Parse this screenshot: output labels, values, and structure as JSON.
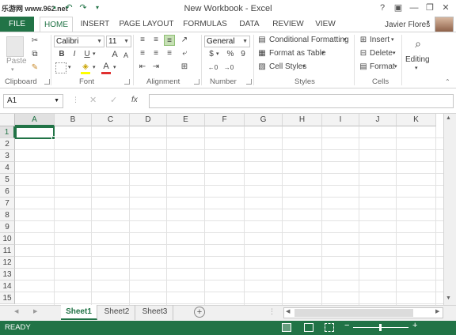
{
  "window": {
    "watermark": "乐游网 www.962.net",
    "title": "New Workbook - Excel",
    "controls": [
      "?",
      "▣",
      "—",
      "❐",
      "✕"
    ]
  },
  "qat": [
    "save-icon",
    "undo-icon",
    "redo-icon"
  ],
  "ribbon": {
    "file_tab": "FILE",
    "tabs": [
      "HOME",
      "INSERT",
      "PAGE LAYOUT",
      "FORMULAS",
      "DATA",
      "REVIEW",
      "VIEW"
    ],
    "active_tab": "HOME",
    "user": "Javier Flores",
    "groups": {
      "clipboard": {
        "label": "Clipboard",
        "paste": "Paste"
      },
      "font": {
        "label": "Font",
        "font_name": "Calibri",
        "font_size": "11",
        "bold": "B",
        "italic": "I",
        "underline": "U"
      },
      "alignment": {
        "label": "Alignment"
      },
      "number": {
        "label": "Number",
        "format": "General",
        "currency": "$",
        "percent": "%",
        "comma": "9"
      },
      "styles": {
        "label": "Styles",
        "conditional": "Conditional Formatting",
        "format_table": "Format as Table",
        "cell_styles": "Cell Styles"
      },
      "cells": {
        "label": "Cells",
        "insert": "Insert",
        "delete": "Delete",
        "format": "Format"
      },
      "editing": {
        "label": "Editing"
      }
    }
  },
  "formula_bar": {
    "name_box": "A1",
    "fx": "fx",
    "value": ""
  },
  "grid": {
    "columns": [
      "A",
      "B",
      "C",
      "D",
      "E",
      "F",
      "G",
      "H",
      "I",
      "J",
      "K"
    ],
    "rows": [
      "1",
      "2",
      "3",
      "4",
      "5",
      "6",
      "7",
      "8",
      "9",
      "10",
      "11",
      "12",
      "13",
      "14",
      "15"
    ],
    "active_cell": "A1"
  },
  "sheets": {
    "tabs": [
      "Sheet1",
      "Sheet2",
      "Sheet3"
    ],
    "active": "Sheet1"
  },
  "status": {
    "text": "READY"
  },
  "colors": {
    "accent": "#217346"
  }
}
